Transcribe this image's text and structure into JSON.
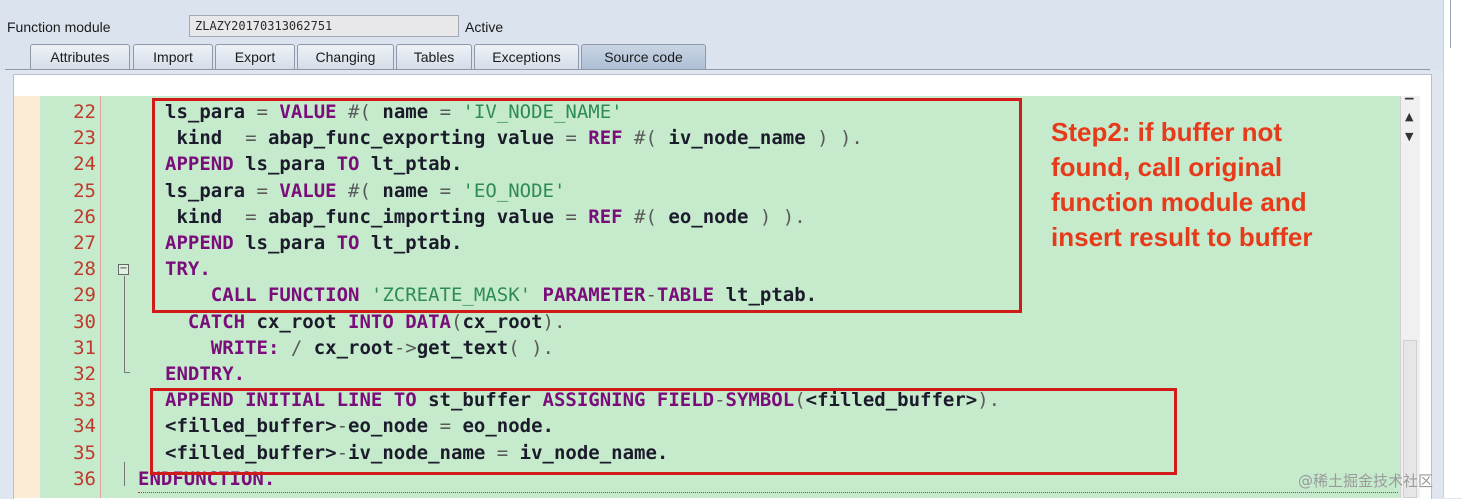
{
  "header": {
    "label": "Function module",
    "value": "ZLAZY20170313062751",
    "status": "Active"
  },
  "tabs": [
    {
      "label": "Attributes",
      "active": false
    },
    {
      "label": "Import",
      "active": false
    },
    {
      "label": "Export",
      "active": false
    },
    {
      "label": "Changing",
      "active": false
    },
    {
      "label": "Tables",
      "active": false
    },
    {
      "label": "Exceptions",
      "active": false
    },
    {
      "label": "Source code",
      "active": true
    }
  ],
  "code": {
    "line_numbers": [
      "22",
      "23",
      "24",
      "25",
      "26",
      "27",
      "28",
      "29",
      "30",
      "31",
      "32",
      "33",
      "34",
      "35",
      "36"
    ],
    "lines": [
      [
        [
          "id",
          "ls_para "
        ],
        [
          "op",
          "= "
        ],
        [
          "kw",
          "VALUE "
        ],
        [
          "op",
          "#( "
        ],
        [
          "id",
          "name "
        ],
        [
          "op",
          "= "
        ],
        [
          "str",
          "'IV_NODE_NAME'"
        ]
      ],
      [
        [
          "id",
          " kind  "
        ],
        [
          "op",
          "= "
        ],
        [
          "id",
          "abap_func_exporting value "
        ],
        [
          "op",
          "= "
        ],
        [
          "kw",
          "REF "
        ],
        [
          "op",
          "#( "
        ],
        [
          "id",
          "iv_node_name "
        ],
        [
          "op",
          ") )."
        ]
      ],
      [
        [
          "kw",
          "APPEND "
        ],
        [
          "id",
          "ls_para "
        ],
        [
          "kw",
          "TO "
        ],
        [
          "id",
          "lt_ptab."
        ]
      ],
      [
        [
          "id",
          "ls_para "
        ],
        [
          "op",
          "= "
        ],
        [
          "kw",
          "VALUE "
        ],
        [
          "op",
          "#( "
        ],
        [
          "id",
          "name "
        ],
        [
          "op",
          "= "
        ],
        [
          "str",
          "'EO_NODE'"
        ]
      ],
      [
        [
          "id",
          " kind  "
        ],
        [
          "op",
          "= "
        ],
        [
          "id",
          "abap_func_importing value "
        ],
        [
          "op",
          "= "
        ],
        [
          "kw",
          "REF "
        ],
        [
          "op",
          "#( "
        ],
        [
          "id",
          "eo_node "
        ],
        [
          "op",
          ") )."
        ]
      ],
      [
        [
          "kw",
          "APPEND "
        ],
        [
          "id",
          "ls_para "
        ],
        [
          "kw",
          "TO "
        ],
        [
          "id",
          "lt_ptab."
        ]
      ],
      [
        [
          "kw",
          "TRY."
        ]
      ],
      [
        [
          "id",
          "    "
        ],
        [
          "kw",
          "CALL FUNCTION "
        ],
        [
          "str",
          "'ZCREATE_MASK' "
        ],
        [
          "kw",
          "PARAMETER"
        ],
        [
          "op",
          "-"
        ],
        [
          "kw",
          "TABLE "
        ],
        [
          "id",
          "lt_ptab."
        ]
      ],
      [
        [
          "id",
          "  "
        ],
        [
          "kw",
          "CATCH "
        ],
        [
          "id",
          "cx_root "
        ],
        [
          "kw",
          "INTO DATA"
        ],
        [
          "op",
          "("
        ],
        [
          "id",
          "cx_root"
        ],
        [
          "op",
          ")."
        ]
      ],
      [
        [
          "id",
          "    "
        ],
        [
          "kw",
          "WRITE: "
        ],
        [
          "op",
          "/ "
        ],
        [
          "id",
          "cx_root"
        ],
        [
          "op",
          "->"
        ],
        [
          "id",
          "get_text"
        ],
        [
          "op",
          "( )."
        ]
      ],
      [
        [
          "kw",
          "ENDTRY."
        ]
      ],
      [
        [
          "kw",
          "APPEND INITIAL LINE TO "
        ],
        [
          "id",
          "st_buffer "
        ],
        [
          "kw",
          "ASSIGNING FIELD"
        ],
        [
          "op",
          "-"
        ],
        [
          "kw",
          "SYMBOL"
        ],
        [
          "op",
          "("
        ],
        [
          "id",
          "<filled_buffer>"
        ],
        [
          "op",
          ")."
        ]
      ],
      [
        [
          "id",
          "<filled_buffer>"
        ],
        [
          "op",
          "-"
        ],
        [
          "id",
          "eo_node "
        ],
        [
          "op",
          "= "
        ],
        [
          "id",
          "eo_node."
        ]
      ],
      [
        [
          "id",
          "<filled_buffer>"
        ],
        [
          "op",
          "-"
        ],
        [
          "id",
          "iv_node_name "
        ],
        [
          "op",
          "= "
        ],
        [
          "id",
          "iv_node_name."
        ]
      ],
      [
        [
          "kw",
          "ENDFUNCTION."
        ]
      ]
    ]
  },
  "annotation": {
    "text_lines": [
      "Step2: if buffer not",
      "found, call original",
      "function module and",
      "insert result to buffer"
    ]
  },
  "watermark": "@稀土掘金技术社区",
  "colors": {
    "code_bg": "#c5ebcc",
    "keyword": "#7a0d7a",
    "string": "#2e8b57",
    "line_number": "#c0392b",
    "highlight_box": "#d11a1a",
    "annotation": "#e63a1a"
  }
}
